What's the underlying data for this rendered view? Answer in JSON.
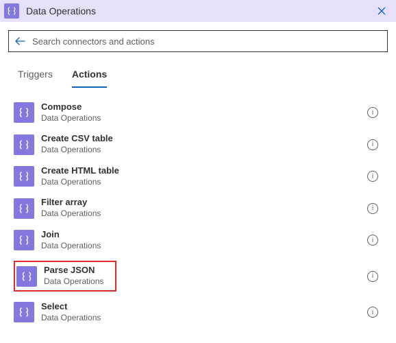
{
  "header": {
    "title": "Data Operations",
    "icon": "data-operations-icon"
  },
  "search": {
    "placeholder": "Search connectors and actions",
    "value": ""
  },
  "tabs": [
    {
      "id": "triggers",
      "label": "Triggers",
      "active": false
    },
    {
      "id": "actions",
      "label": "Actions",
      "active": true
    }
  ],
  "actions": [
    {
      "title": "Compose",
      "subtitle": "Data Operations",
      "highlighted": false
    },
    {
      "title": "Create CSV table",
      "subtitle": "Data Operations",
      "highlighted": false
    },
    {
      "title": "Create HTML table",
      "subtitle": "Data Operations",
      "highlighted": false
    },
    {
      "title": "Filter array",
      "subtitle": "Data Operations",
      "highlighted": false
    },
    {
      "title": "Join",
      "subtitle": "Data Operations",
      "highlighted": false
    },
    {
      "title": "Parse JSON",
      "subtitle": "Data Operations",
      "highlighted": true
    },
    {
      "title": "Select",
      "subtitle": "Data Operations",
      "highlighted": false
    }
  ],
  "colors": {
    "accent": "#8378de",
    "header_bg": "#e6e0fa",
    "link": "#0b62c1",
    "highlight_border": "#e12a2a"
  }
}
